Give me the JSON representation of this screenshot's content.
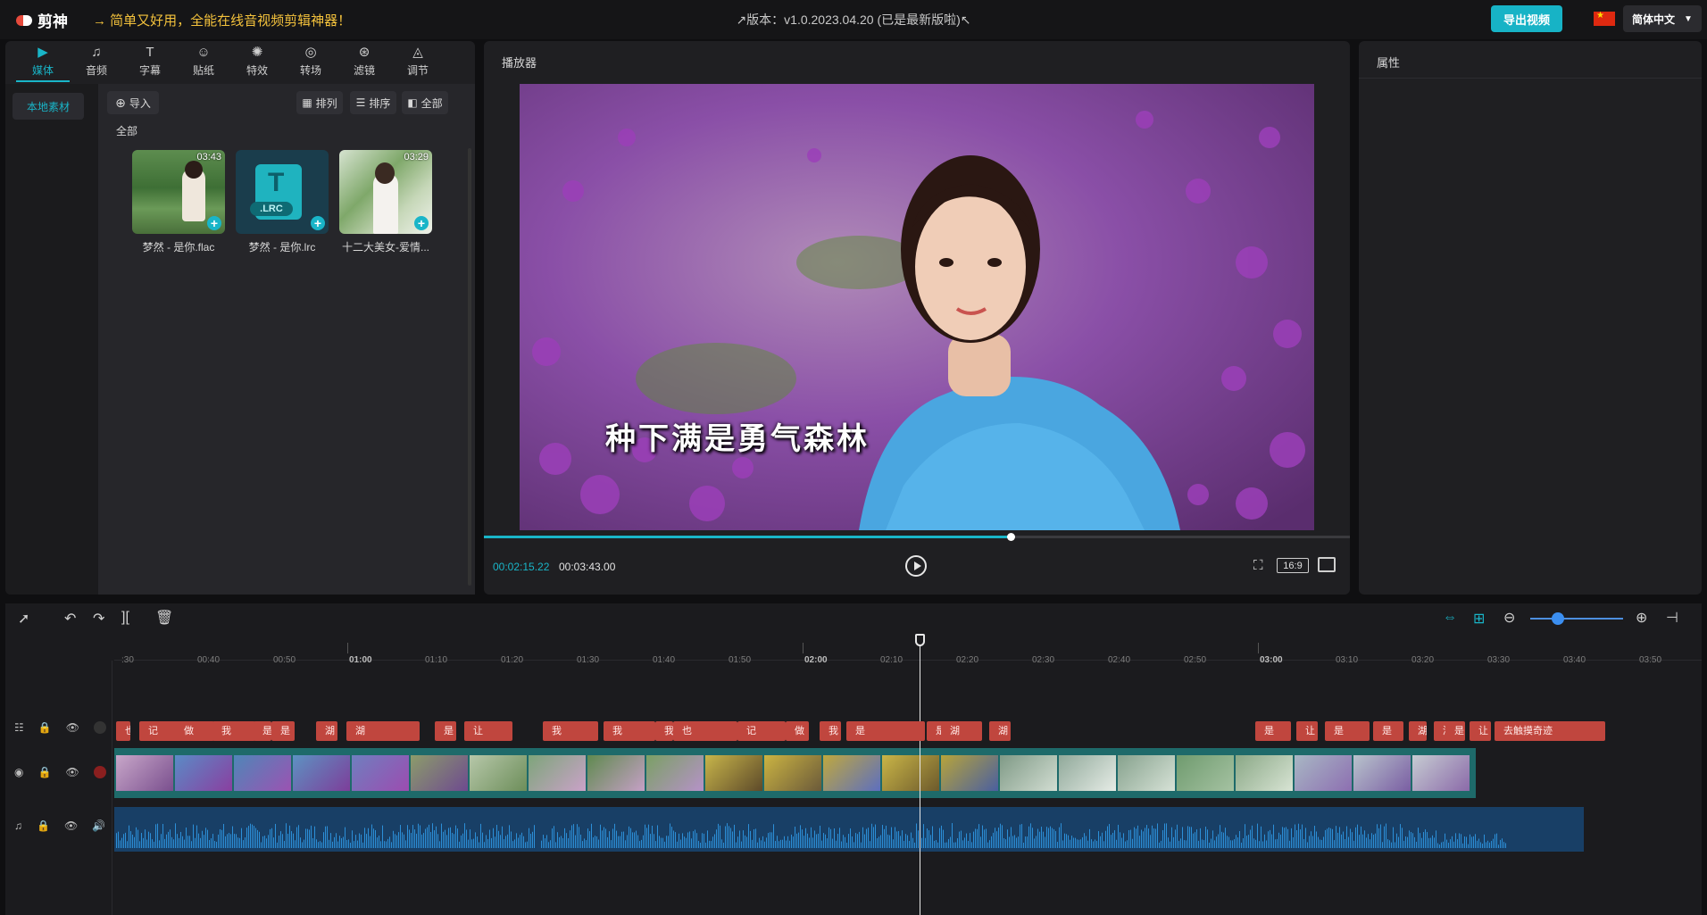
{
  "app": {
    "logo_text": "剪神",
    "slogan": "→ 简单又好用，全能在线音视频剪辑神器！",
    "version": "↗版本：v1.0.2023.04.20 (已是最新版啦)↖",
    "export_label": "导出视频",
    "language": "简体中文"
  },
  "tabs": [
    {
      "icon": "▶",
      "label": "媒体"
    },
    {
      "icon": "♫",
      "label": "音频"
    },
    {
      "icon": "T",
      "label": "字幕"
    },
    {
      "icon": "☺",
      "label": "贴纸"
    },
    {
      "icon": "✺",
      "label": "特效"
    },
    {
      "icon": "◎",
      "label": "转场"
    },
    {
      "icon": "⊛",
      "label": "滤镜"
    },
    {
      "icon": "◬",
      "label": "调节"
    }
  ],
  "media": {
    "local_label": "本地素材",
    "import_label": "导入",
    "arrange_label": "排列",
    "sort_label": "排序",
    "all_filter_label": "全部",
    "section_label": "全部",
    "items": [
      {
        "name": "梦然 - 是你.flac",
        "duration": "03:43"
      },
      {
        "name": "梦然 - 是你.lrc",
        "badge": ".LRC"
      },
      {
        "name": "十二大美女-爱情...",
        "duration": "03:29"
      }
    ]
  },
  "player": {
    "title": "播放器",
    "subtitle": "种下满是勇气森林",
    "current_time": "00:02:15.22",
    "total_time": "00:03:43.00",
    "aspect": "16:9",
    "progress": 0.608
  },
  "properties": {
    "title": "属性"
  },
  "timeline": {
    "ticks": [
      ":30",
      "00:40",
      "00:50",
      "01:00",
      "01:10",
      "01:20",
      "01:30",
      "01:40",
      "01:50",
      "02:00",
      "02:10",
      "02:20",
      "02:30",
      "02:40",
      "02:50",
      "03:00",
      "03:10",
      "03:20",
      "03:30",
      "03:40",
      "03:50"
    ],
    "major_ticks": [
      "01:00",
      "02:00",
      "03:00"
    ],
    "subtitle_clips": [
      "也",
      "记",
      "做",
      "我",
      "是",
      "是",
      "湖",
      "湖",
      "是",
      "让",
      "我",
      "我",
      "我",
      "也",
      "记",
      "做",
      "我",
      "是",
      "是",
      "湖",
      "湖",
      "是",
      "让",
      "是",
      "是",
      "湖",
      "湖",
      "是",
      "让",
      "去触摸奇迹"
    ],
    "zoom": 0.3
  },
  "colors": {
    "accent": "#19b5c8",
    "subtitle_clip": "#c0463e",
    "video_track": "#1e6a6a",
    "audio_track": "#183f66",
    "slogan": "#f4c23c"
  }
}
